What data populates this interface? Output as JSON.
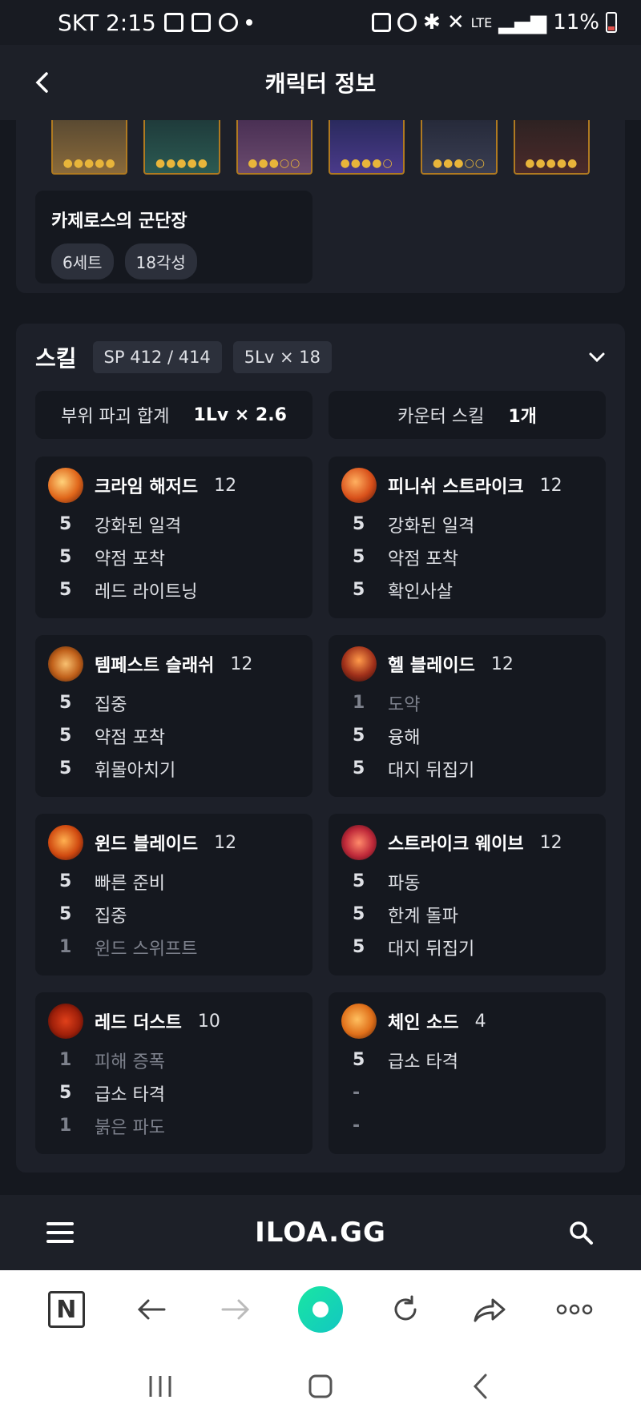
{
  "status_bar": {
    "carrier_time": "SKT 2:15",
    "network": "LTE",
    "battery": "11%"
  },
  "header": {
    "title": "캐릭터 정보"
  },
  "gems": {
    "pips": [
      "●●●●●",
      "●●●●●",
      "●●●○○",
      "●●●●○",
      "●●●○○",
      "●●●●●"
    ]
  },
  "set": {
    "title": "카제로스의 군단장",
    "chips": [
      "6세트",
      "18각성"
    ]
  },
  "skills_section": {
    "heading": "스킬",
    "sp": "SP 412 / 414",
    "lv": "5Lv × 18",
    "part_break_label": "부위 파괴 합계",
    "part_break_value": "1Lv × 2.6",
    "counter_label": "카운터 스킬",
    "counter_value": "1개"
  },
  "skills": [
    {
      "name": "크라임 해저드",
      "level": "12",
      "tripods": [
        {
          "lv": "5",
          "name": "강화된 일격",
          "dim": false
        },
        {
          "lv": "5",
          "name": "약점 포착",
          "dim": false
        },
        {
          "lv": "5",
          "name": "레드 라이트닝",
          "dim": false
        }
      ]
    },
    {
      "name": "피니쉬 스트라이크",
      "level": "12",
      "tripods": [
        {
          "lv": "5",
          "name": "강화된 일격",
          "dim": false
        },
        {
          "lv": "5",
          "name": "약점 포착",
          "dim": false
        },
        {
          "lv": "5",
          "name": "확인사살",
          "dim": false
        }
      ]
    },
    {
      "name": "템페스트 슬래쉬",
      "level": "12",
      "tripods": [
        {
          "lv": "5",
          "name": "집중",
          "dim": false
        },
        {
          "lv": "5",
          "name": "약점 포착",
          "dim": false
        },
        {
          "lv": "5",
          "name": "휘몰아치기",
          "dim": false
        }
      ]
    },
    {
      "name": "헬 블레이드",
      "level": "12",
      "tripods": [
        {
          "lv": "1",
          "name": "도약",
          "dim": true
        },
        {
          "lv": "5",
          "name": "융해",
          "dim": false
        },
        {
          "lv": "5",
          "name": "대지 뒤집기",
          "dim": false
        }
      ]
    },
    {
      "name": "윈드 블레이드",
      "level": "12",
      "tripods": [
        {
          "lv": "5",
          "name": "빠른 준비",
          "dim": false
        },
        {
          "lv": "5",
          "name": "집중",
          "dim": false
        },
        {
          "lv": "1",
          "name": "윈드 스위프트",
          "dim": true
        }
      ]
    },
    {
      "name": "스트라이크 웨이브",
      "level": "12",
      "tripods": [
        {
          "lv": "5",
          "name": "파동",
          "dim": false
        },
        {
          "lv": "5",
          "name": "한계 돌파",
          "dim": false
        },
        {
          "lv": "5",
          "name": "대지 뒤집기",
          "dim": false
        }
      ]
    },
    {
      "name": "레드 더스트",
      "level": "10",
      "tripods": [
        {
          "lv": "1",
          "name": "피해 증폭",
          "dim": true
        },
        {
          "lv": "5",
          "name": "급소 타격",
          "dim": false
        },
        {
          "lv": "1",
          "name": "붉은 파도",
          "dim": true
        }
      ]
    },
    {
      "name": "체인 소드",
      "level": "4",
      "tripods": [
        {
          "lv": "5",
          "name": "급소 타격",
          "dim": false
        },
        {
          "lv": "-",
          "name": "",
          "dim": true
        },
        {
          "lv": "-",
          "name": "",
          "dim": true
        }
      ]
    }
  ],
  "bottom_bar": {
    "logo": "ILOA.GG"
  },
  "browser_bar": {
    "n_label": "N"
  }
}
